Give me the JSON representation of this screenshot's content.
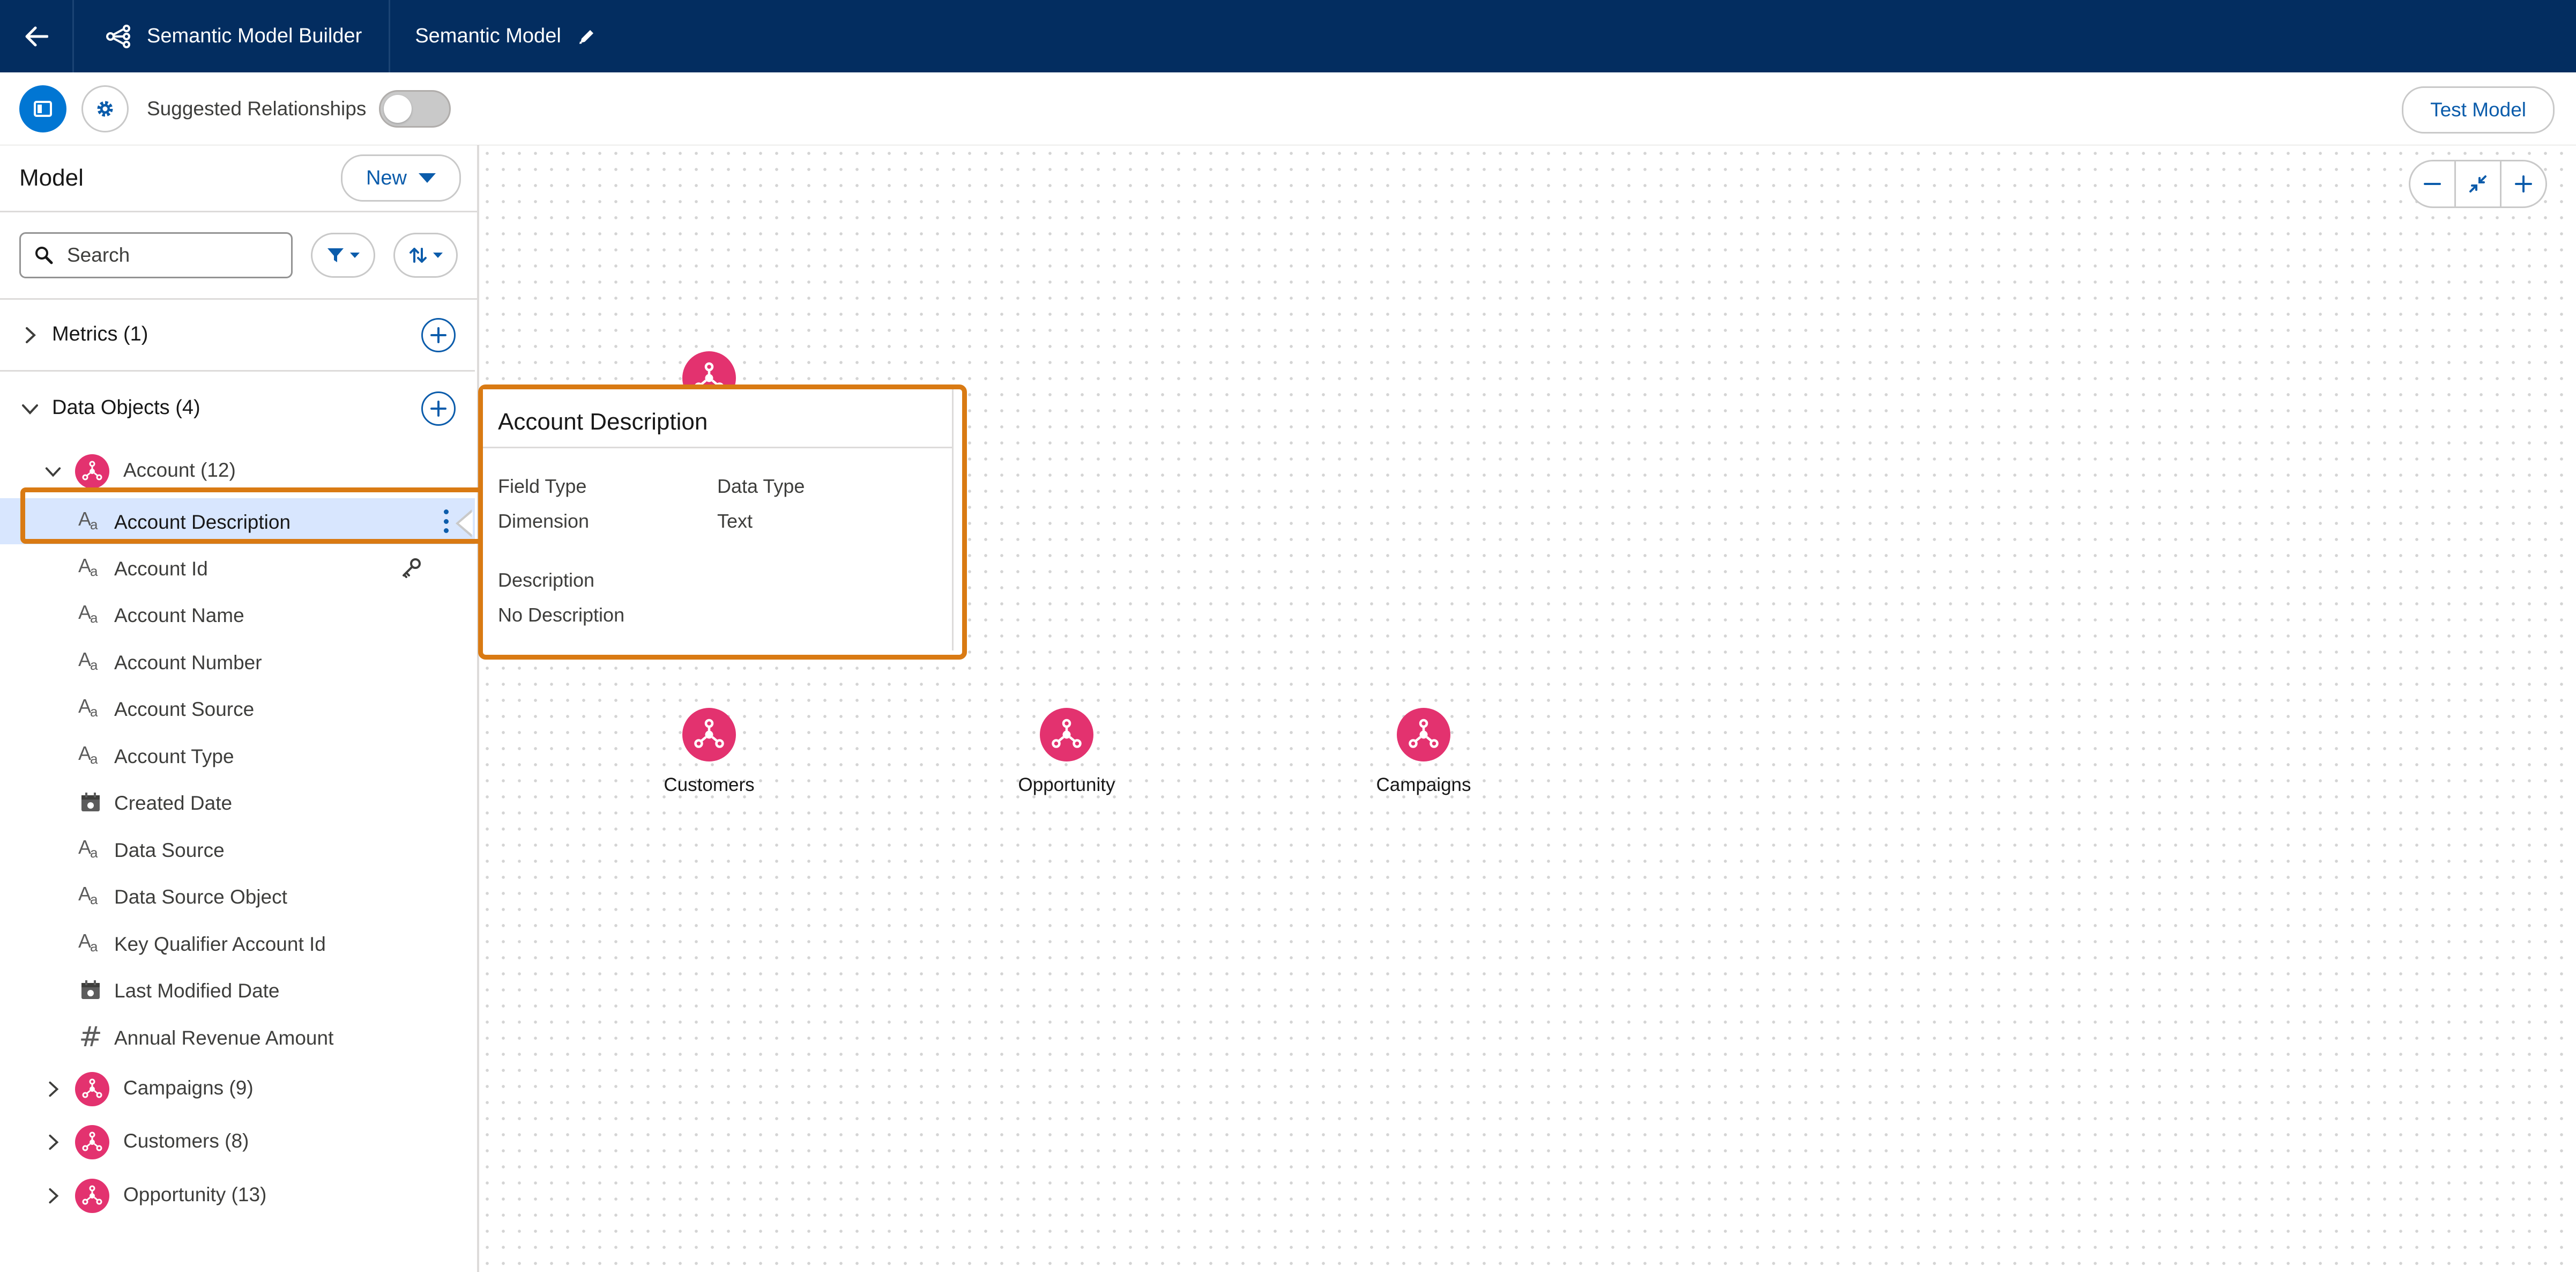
{
  "header": {
    "app_name": "Semantic Model Builder",
    "model_name": "Semantic Model"
  },
  "toolbar": {
    "suggested_label": "Suggested Relationships",
    "suggested_enabled": false,
    "test_label": "Test Model"
  },
  "left_panel": {
    "title": "Model",
    "new_label": "New",
    "search_placeholder": "Search",
    "metrics_label": "Metrics (1)",
    "data_objects_label": "Data Objects (4)",
    "account": {
      "label": "Account (12)",
      "fields": [
        {
          "label": "Account Description",
          "type": "text-icon",
          "selected": true
        },
        {
          "label": "Account Id",
          "type": "text-icon",
          "key": true
        },
        {
          "label": "Account Name",
          "type": "text-icon"
        },
        {
          "label": "Account Number",
          "type": "text-icon"
        },
        {
          "label": "Account Source",
          "type": "text-icon"
        },
        {
          "label": "Account Type",
          "type": "text-icon"
        },
        {
          "label": "Created Date",
          "type": "calendar-icon"
        },
        {
          "label": "Data Source",
          "type": "text-icon"
        },
        {
          "label": "Data Source Object",
          "type": "text-icon"
        },
        {
          "label": "Key Qualifier Account Id",
          "type": "text-icon"
        },
        {
          "label": "Last Modified Date",
          "type": "calendar-icon"
        },
        {
          "label": "Annual Revenue Amount",
          "type": "number-icon"
        }
      ]
    },
    "other_objects": [
      {
        "label": "Campaigns (9)"
      },
      {
        "label": "Customers (8)"
      },
      {
        "label": "Opportunity (13)"
      }
    ]
  },
  "canvas": {
    "nodes": [
      {
        "label": "Customers"
      },
      {
        "label": "Opportunity"
      },
      {
        "label": "Campaigns"
      }
    ]
  },
  "popover": {
    "title": "Account Description",
    "field_type_label": "Field Type",
    "field_type_value": "Dimension",
    "data_type_label": "Data Type",
    "data_type_value": "Text",
    "description_label": "Description",
    "description_value": "No Description"
  },
  "colors": {
    "nav": "#032d60",
    "brand": "#0176d3",
    "object_icon": "#e3326f",
    "highlight": "#d97a13",
    "selected_row": "#d8e6fe"
  }
}
